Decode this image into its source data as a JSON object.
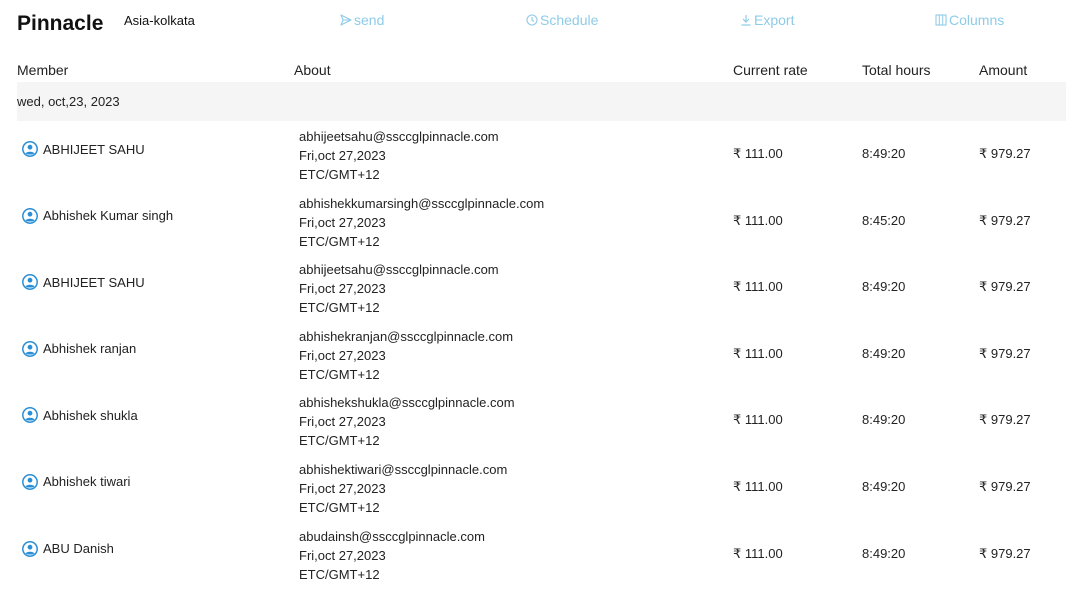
{
  "app": {
    "brand": "Pinnacle",
    "timezone": "Asia-kolkata"
  },
  "actions": {
    "send": "send",
    "schedule": "Schedule",
    "export": "Export",
    "columns": "Columns",
    "accent_color": "#8ecbe8"
  },
  "table": {
    "headers": {
      "member": "Member",
      "about": "About",
      "rate": "Current rate",
      "hours": "Total hours",
      "amount": "Amount"
    },
    "group_date": "wed, oct,23, 2023",
    "rows": [
      {
        "name": "ABHIJEET SAHU",
        "email": "abhijeetsahu@ssccglpinnacle.com",
        "date": "Fri,oct 27,2023",
        "tz": "ETC/GMT+12",
        "rate": "₹ 111.00",
        "hours": "8:49:20",
        "amount": "₹ 979.27"
      },
      {
        "name": "Abhishek Kumar singh",
        "email": "abhishekkumarsingh@ssccglpinnacle.com",
        "date": "Fri,oct 27,2023",
        "tz": "ETC/GMT+12",
        "rate": "₹ 111.00",
        "hours": "8:45:20",
        "amount": "₹ 979.27"
      },
      {
        "name": "ABHIJEET SAHU",
        "email": "abhijeetsahu@ssccglpinnacle.com",
        "date": "Fri,oct 27,2023",
        "tz": "ETC/GMT+12",
        "rate": "₹ 111.00",
        "hours": "8:49:20",
        "amount": "₹ 979.27"
      },
      {
        "name": "Abhishek ranjan",
        "email": "abhishekranjan@ssccglpinnacle.com",
        "date": "Fri,oct 27,2023",
        "tz": "ETC/GMT+12",
        "rate": "₹ 111.00",
        "hours": "8:49:20",
        "amount": "₹ 979.27"
      },
      {
        "name": "Abhishek shukla",
        "email": "abhishekshukla@ssccglpinnacle.com",
        "date": "Fri,oct 27,2023",
        "tz": "ETC/GMT+12",
        "rate": "₹ 111.00",
        "hours": "8:49:20",
        "amount": "₹ 979.27"
      },
      {
        "name": "Abhishek tiwari",
        "email": "abhishektiwari@ssccglpinnacle.com",
        "date": "Fri,oct 27,2023",
        "tz": "ETC/GMT+12",
        "rate": "₹ 111.00",
        "hours": "8:49:20",
        "amount": "₹ 979.27"
      },
      {
        "name": "ABU Danish",
        "email": "abudainsh@ssccglpinnacle.com",
        "date": "Fri,oct 27,2023",
        "tz": "ETC/GMT+12",
        "rate": "₹ 111.00",
        "hours": "8:49:20",
        "amount": "₹ 979.27"
      }
    ]
  },
  "icons": {
    "send": "send-icon",
    "schedule": "clock-icon",
    "export": "download-icon",
    "columns": "columns-icon",
    "member": "user-avatar-icon"
  }
}
